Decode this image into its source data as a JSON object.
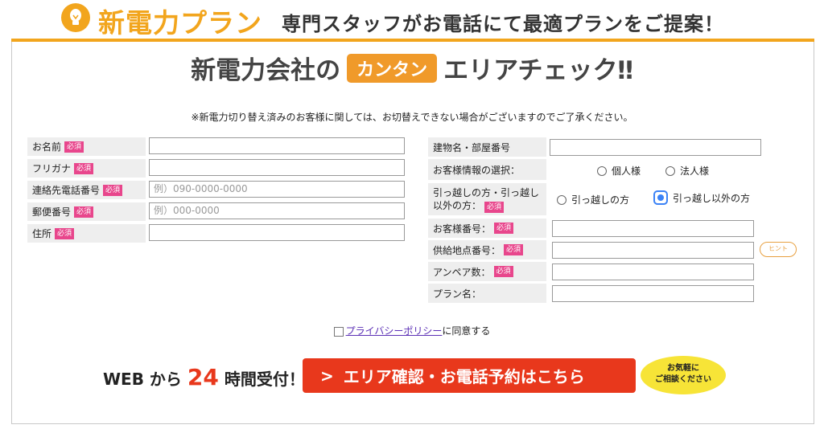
{
  "header": {
    "brand": "新電力プラン",
    "tagline": "専門スタッフがお電話にて最適プランをご提案！"
  },
  "title": {
    "pre": "新電力会社の",
    "badge": "カンタン",
    "post": "エリアチェック‼"
  },
  "notice": "※新電力切り替え済みのお客様に関しては、お切替えできない場合がございますのでご了承ください。",
  "required_label": "必須",
  "left_form": {
    "name": {
      "label": "お名前",
      "value": ""
    },
    "furigana": {
      "label": "フリガナ",
      "value": ""
    },
    "phone": {
      "label": "連絡先電話番号",
      "placeholder": "例）090-0000-0000"
    },
    "postal": {
      "label": "郵便番号",
      "placeholder": "例）000-0000"
    },
    "address": {
      "label": "住所",
      "value": ""
    }
  },
  "right_form": {
    "building": {
      "label": "建物名・部屋番号",
      "value": ""
    },
    "customer_type": {
      "label": "お客様情報の選択：",
      "options": [
        "個人様",
        "法人様"
      ]
    },
    "moving": {
      "label_line1": "引っ越しの方・引っ越し",
      "label_line2": "以外の方：",
      "options": [
        "引っ越しの方",
        "引っ越し以外の方"
      ],
      "selected": "引っ越し以外の方"
    },
    "customer_number": {
      "label": "お客様番号："
    },
    "supply_point": {
      "label": "供給地点番号：",
      "hint": "ヒント"
    },
    "ampere": {
      "label": "アンペア数："
    },
    "plan_name": {
      "label": "プラン名："
    }
  },
  "privacy": {
    "link": "プライバシーポリシー",
    "suffix": "に同意する"
  },
  "cta": {
    "web_prefix": "WEB から",
    "web_number": "24",
    "web_suffix": "時間受付！",
    "chevron": ">",
    "button_label": "エリア確認・お電話予約はこちら",
    "bubble_line1": "お気軽に",
    "bubble_line2": "ご相談ください"
  },
  "colors": {
    "accent_orange": "#f2a51d",
    "required_pink": "#e8468c",
    "cta_red": "#e8381c",
    "bubble_yellow": "#f7e437"
  },
  "icons": {
    "bulb": "lightbulb-icon"
  }
}
